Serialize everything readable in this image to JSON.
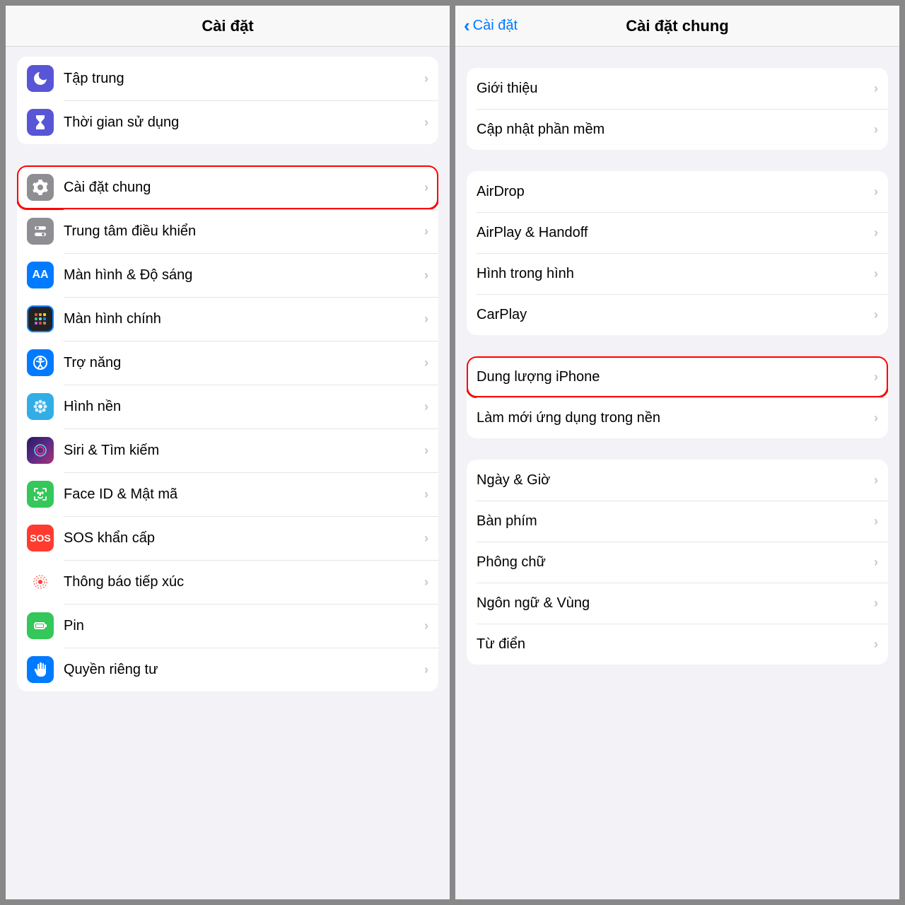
{
  "left": {
    "title": "Cài đặt",
    "groups": [
      {
        "icons": true,
        "items": [
          {
            "label": "Tập trung",
            "icon": "moon-icon",
            "bg": "bg-purple"
          },
          {
            "label": "Thời gian sử dụng",
            "icon": "hourglass-icon",
            "bg": "bg-purple"
          }
        ]
      },
      {
        "icons": true,
        "items": [
          {
            "label": "Cài đặt chung",
            "icon": "gear-icon",
            "bg": "bg-gray",
            "highlight": true
          },
          {
            "label": "Trung tâm điều khiển",
            "icon": "toggles-icon",
            "bg": "bg-gray"
          },
          {
            "label": "Màn hình & Độ sáng",
            "icon": "aa-icon",
            "bg": "bg-blue"
          },
          {
            "label": "Màn hình chính",
            "icon": "grid-icon",
            "bg": "bg-multi"
          },
          {
            "label": "Trợ năng",
            "icon": "accessibility-icon",
            "bg": "bg-blue"
          },
          {
            "label": "Hình nền",
            "icon": "flower-icon",
            "bg": "bg-lblue"
          },
          {
            "label": "Siri & Tìm kiếm",
            "icon": "siri-icon",
            "bg": "bg-siri"
          },
          {
            "label": "Face ID & Mật mã",
            "icon": "faceid-icon",
            "bg": "bg-green"
          },
          {
            "label": "SOS khẩn cấp",
            "icon": "sos-icon",
            "bg": "bg-red"
          },
          {
            "label": "Thông báo tiếp xúc",
            "icon": "exposure-icon",
            "bg": "bg-pink"
          },
          {
            "label": "Pin",
            "icon": "battery-icon",
            "bg": "bg-green"
          },
          {
            "label": "Quyền riêng tư",
            "icon": "hand-icon",
            "bg": "bg-blue"
          }
        ]
      }
    ]
  },
  "right": {
    "title": "Cài đặt chung",
    "back": "Cài đặt",
    "groups": [
      {
        "items": [
          {
            "label": "Giới thiệu"
          },
          {
            "label": "Cập nhật phần mềm"
          }
        ]
      },
      {
        "items": [
          {
            "label": "AirDrop"
          },
          {
            "label": "AirPlay & Handoff"
          },
          {
            "label": "Hình trong hình"
          },
          {
            "label": "CarPlay"
          }
        ]
      },
      {
        "items": [
          {
            "label": "Dung lượng iPhone",
            "highlight": true
          },
          {
            "label": "Làm mới ứng dụng trong nền"
          }
        ]
      },
      {
        "items": [
          {
            "label": "Ngày & Giờ"
          },
          {
            "label": "Bàn phím"
          },
          {
            "label": "Phông chữ"
          },
          {
            "label": "Ngôn ngữ & Vùng"
          },
          {
            "label": "Từ điển"
          }
        ]
      }
    ]
  }
}
